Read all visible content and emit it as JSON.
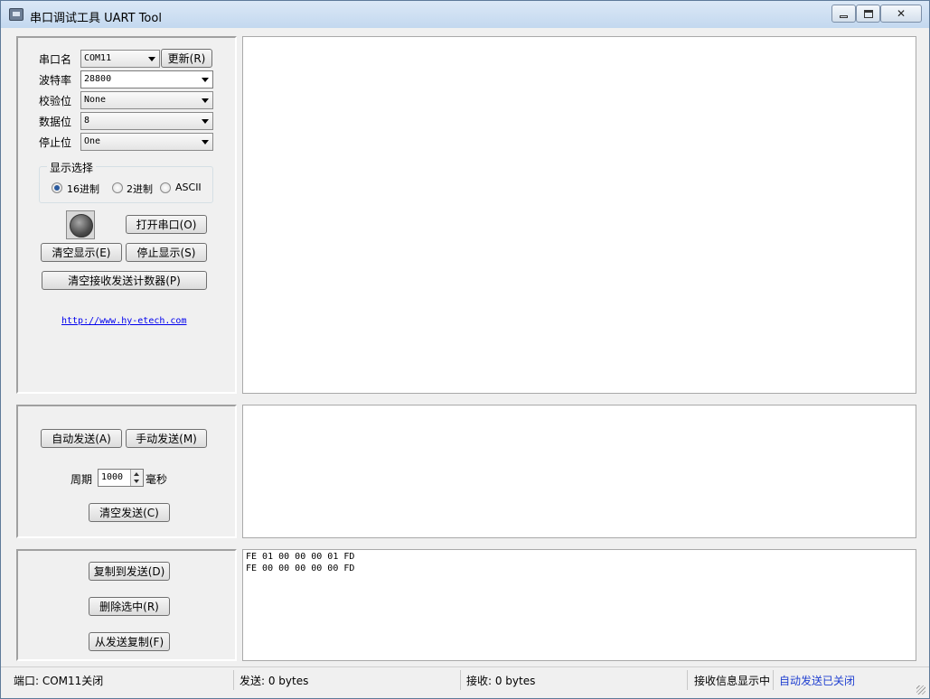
{
  "window": {
    "title": "串口调试工具 UART Tool"
  },
  "serial": {
    "port_label": "串口名",
    "port_value": "COM11",
    "refresh_label": "更新(R)",
    "baud_label": "波特率",
    "baud_value": "28800",
    "parity_label": "校验位",
    "parity_value": "None",
    "databits_label": "数据位",
    "databits_value": "8",
    "stopbits_label": "停止位",
    "stopbits_value": "One"
  },
  "display": {
    "group_title": "显示选择",
    "options": [
      {
        "label": "16进制",
        "selected": true
      },
      {
        "label": "2进制",
        "selected": false
      },
      {
        "label": "ASCII",
        "selected": false
      }
    ]
  },
  "controls": {
    "open_port": "打开串口(O)",
    "clear_display": "清空显示(E)",
    "stop_display": "停止显示(S)",
    "clear_counters": "清空接收发送计数器(P)",
    "website": "http://www.hy-etech.com"
  },
  "send": {
    "auto_send": "自动发送(A)",
    "manual_send": "手动发送(M)",
    "period_label": "周期",
    "period_value": "1000",
    "period_unit": "毫秒",
    "clear_send": "清空发送(C)"
  },
  "history": {
    "copy_to_send": "复制到发送(D)",
    "delete_selected": "删除选中(R)",
    "copy_from_send": "从发送复制(F)",
    "items": [
      "FE 01 00 00 00 01 FD",
      "FE 00 00 00 00 00 FD"
    ]
  },
  "status": {
    "port": "端口: COM11关闭",
    "sent": "发送: 0 bytes",
    "received": "接收: 0 bytes",
    "rx_info": "接收信息显示中",
    "auto_send_status": "自动发送已关闭",
    "auto_send_color": "#1f3fd0"
  }
}
